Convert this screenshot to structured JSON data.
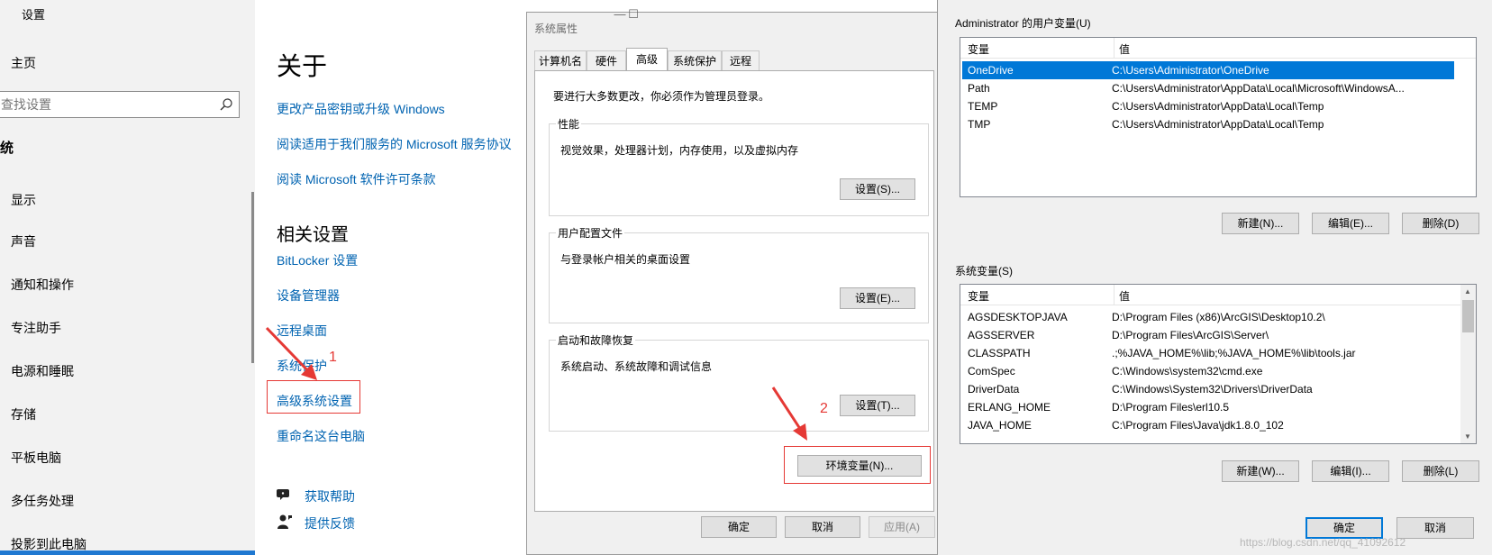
{
  "settings": {
    "window_title": "设置",
    "home": "主页",
    "search_placeholder": "查找设置",
    "section": "统",
    "nav": [
      "显示",
      "声音",
      "通知和操作",
      "专注助手",
      "电源和睡眠",
      "存储",
      "平板电脑",
      "多任务处理",
      "投影到此电脑"
    ],
    "about_title": "关于",
    "links": [
      "更改产品密钥或升级 Windows",
      "阅读适用于我们服务的 Microsoft 服务协议",
      "阅读 Microsoft 软件许可条款"
    ],
    "related_title": "相关设置",
    "related_links": [
      "BitLocker 设置",
      "设备管理器",
      "远程桌面",
      "系统保护",
      "高级系统设置",
      "重命名这台电脑"
    ],
    "help": "获取帮助",
    "feedback": "提供反馈",
    "annotation_1": "1"
  },
  "sysprops": {
    "title": "系统属性",
    "tabs": [
      "计算机名",
      "硬件",
      "高级",
      "系统保护",
      "远程"
    ],
    "active_tab": "高级",
    "note": "要进行大多数更改，你必须作为管理员登录。",
    "groups": [
      {
        "label": "性能",
        "desc": "视觉效果，处理器计划，内存使用，以及虚拟内存",
        "button": "设置(S)..."
      },
      {
        "label": "用户配置文件",
        "desc": "与登录帐户相关的桌面设置",
        "button": "设置(E)..."
      },
      {
        "label": "启动和故障恢复",
        "desc": "系统启动、系统故障和调试信息",
        "button": "设置(T)..."
      }
    ],
    "env_button": "环境变量(N)...",
    "annotation_2": "2",
    "ok": "确定",
    "cancel": "取消",
    "apply": "应用(A)"
  },
  "envvars": {
    "user_label": "Administrator 的用户变量(U)",
    "col_var": "变量",
    "col_val": "值",
    "user_vars": [
      {
        "name": "OneDrive",
        "value": "C:\\Users\\Administrator\\OneDrive"
      },
      {
        "name": "Path",
        "value": "C:\\Users\\Administrator\\AppData\\Local\\Microsoft\\WindowsA..."
      },
      {
        "name": "TEMP",
        "value": "C:\\Users\\Administrator\\AppData\\Local\\Temp"
      },
      {
        "name": "TMP",
        "value": "C:\\Users\\Administrator\\AppData\\Local\\Temp"
      }
    ],
    "user_buttons": [
      "新建(N)...",
      "编辑(E)...",
      "删除(D)"
    ],
    "sys_label": "系统变量(S)",
    "sys_vars": [
      {
        "name": "AGSDESKTOPJAVA",
        "value": "D:\\Program Files (x86)\\ArcGIS\\Desktop10.2\\"
      },
      {
        "name": "AGSSERVER",
        "value": "D:\\Program Files\\ArcGIS\\Server\\"
      },
      {
        "name": "CLASSPATH",
        "value": ".;%JAVA_HOME%\\lib;%JAVA_HOME%\\lib\\tools.jar"
      },
      {
        "name": "ComSpec",
        "value": "C:\\Windows\\system32\\cmd.exe"
      },
      {
        "name": "DriverData",
        "value": "C:\\Windows\\System32\\Drivers\\DriverData"
      },
      {
        "name": "ERLANG_HOME",
        "value": "D:\\Program Files\\erl10.5"
      },
      {
        "name": "JAVA_HOME",
        "value": "C:\\Program Files\\Java\\jdk1.8.0_102"
      }
    ],
    "sys_buttons": [
      "新建(W)...",
      "编辑(I)...",
      "删除(L)"
    ],
    "ok": "确定",
    "cancel": "取消",
    "watermark": "https://blog.csdn.net/qq_41092612"
  },
  "colors": {
    "link": "#0063b1",
    "annotation": "#e53935",
    "selection": "#0078d7",
    "accent_strip": "#1f78d1"
  }
}
